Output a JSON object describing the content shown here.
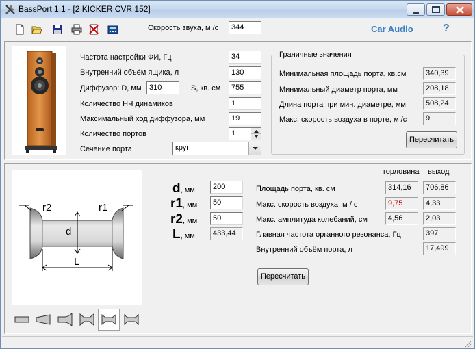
{
  "window": {
    "title": "BassPort 1.1 - [2 KICKER CVR 152]"
  },
  "toolbar": {
    "icons": [
      "new-file-icon",
      "open-folder-icon",
      "save-disk-icon",
      "print-icon",
      "delete-icon",
      "calculator-icon"
    ],
    "sound_speed_label": "Скорость звука, м /с",
    "sound_speed_value": "344",
    "brand": "Car Audio",
    "help": "?"
  },
  "params": {
    "tuning_freq_label": "Частота настройки ФИ, Гц",
    "tuning_freq_value": "34",
    "volume_label": "Внутренний объём ящика, л",
    "volume_value": "130",
    "diffuser_label": "Диффузор: D, мм",
    "diffuser_d_value": "310",
    "s_label": "S, кв. см",
    "s_value": "755",
    "drivers_label": "Количество НЧ динамиков",
    "drivers_value": "1",
    "xmax_label": "Максимальный ход диффузора, мм",
    "xmax_value": "19",
    "ports_label": "Количество портов",
    "ports_value": "1",
    "section_label": "Сечение порта",
    "section_value": "круг"
  },
  "limits": {
    "title": "Граничные значения",
    "min_area_label": "Минимальная площадь порта, кв.см",
    "min_area_value": "340,39",
    "min_diam_label": "Минимальный диаметр порта, мм",
    "min_diam_value": "208,18",
    "port_len_label": "Длина порта при мин. диаметре, мм",
    "port_len_value": "508,24",
    "max_air_label": "Макс. скорость воздуха в порте, м /с",
    "max_air_value": "9",
    "recalc": "Пересчитать"
  },
  "port": {
    "diagram_labels": {
      "r2": "r2",
      "r1": "r1",
      "d": "d",
      "L": "L"
    },
    "d_symbol": "d",
    "r1_symbol": "r1",
    "r2_symbol": "r2",
    "L_symbol": "L",
    "unit": ", мм",
    "d_value": "200",
    "r1_value": "50",
    "r2_value": "50",
    "L_value": "433,44",
    "col_throat": "горловина",
    "col_exit": "выход",
    "area_label": "Площадь порта, кв. см",
    "area_throat": "314,16",
    "area_exit": "706,86",
    "air_speed_label": "Макс. скорость воздуха, м / с",
    "air_speed_throat": "9,75",
    "air_speed_exit": "4,33",
    "amplitude_label": "Макс. амплитуда колебаний, см",
    "amplitude_throat": "4,56",
    "amplitude_exit": "2,03",
    "resonance_label": "Главная частота органного резонанса, Гц",
    "resonance_value": "397",
    "port_volume_label": "Внутренний объём порта, л",
    "port_volume_value": "17,499",
    "recalc": "Пересчитать",
    "shapes": [
      "straight-port-icon",
      "conical-port-icon",
      "horn-port-icon",
      "double-flare-port-icon",
      "flared-round-port-icon",
      "flared-both-ends-port-icon"
    ]
  },
  "colors": {
    "brand": "#3a7fc1",
    "warning_value": "#c00000"
  }
}
